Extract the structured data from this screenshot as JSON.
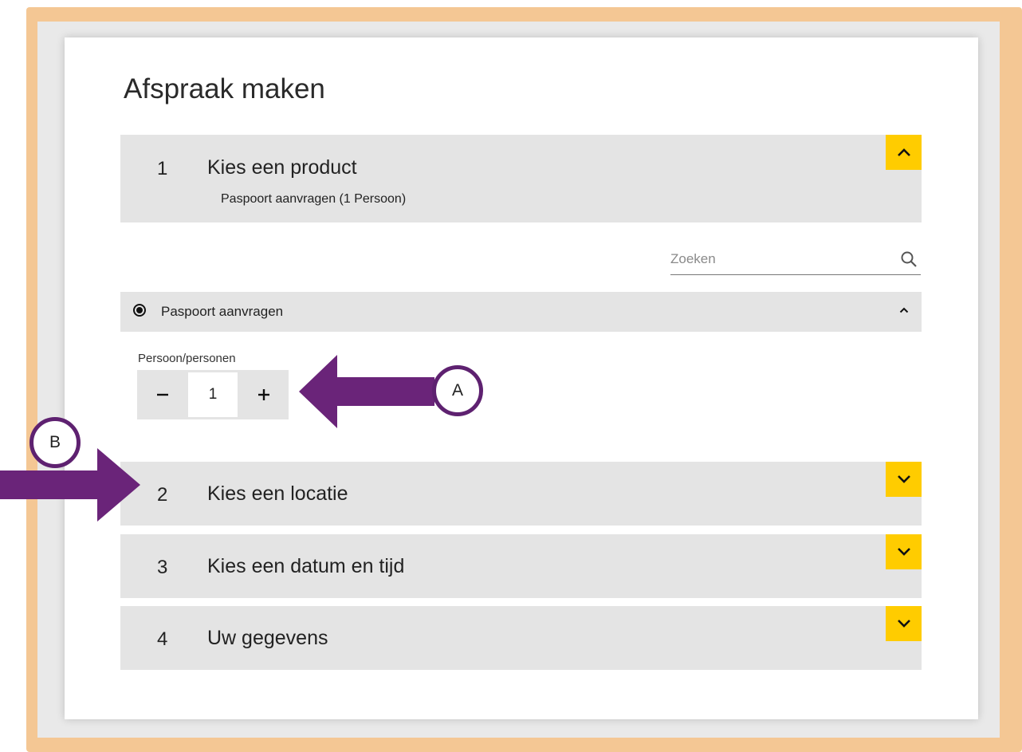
{
  "page": {
    "title": "Afspraak maken"
  },
  "steps": [
    {
      "number": "1",
      "title": "Kies een product",
      "subtitle": "Paspoort aanvragen (1 Persoon)",
      "toggle_icon": "chevron-up-icon"
    },
    {
      "number": "2",
      "title": "Kies een locatie",
      "toggle_icon": "chevron-down-icon"
    },
    {
      "number": "3",
      "title": "Kies een datum en tijd",
      "toggle_icon": "chevron-down-icon"
    },
    {
      "number": "4",
      "title": "Uw gegevens",
      "toggle_icon": "chevron-down-icon"
    }
  ],
  "search": {
    "placeholder": "Zoeken",
    "icon": "search-icon"
  },
  "product": {
    "label": "Paspoort aanvragen",
    "selected": true
  },
  "persons": {
    "label": "Persoon/personen",
    "value": "1"
  },
  "annotations": [
    {
      "label": "A",
      "target": "persons-stepper"
    },
    {
      "label": "B",
      "target": "step-2"
    }
  ],
  "colors": {
    "frame": "#f4c794",
    "accent": "#ffcc00",
    "panel": "#e4e4e4",
    "annotation": "#6a2479"
  }
}
